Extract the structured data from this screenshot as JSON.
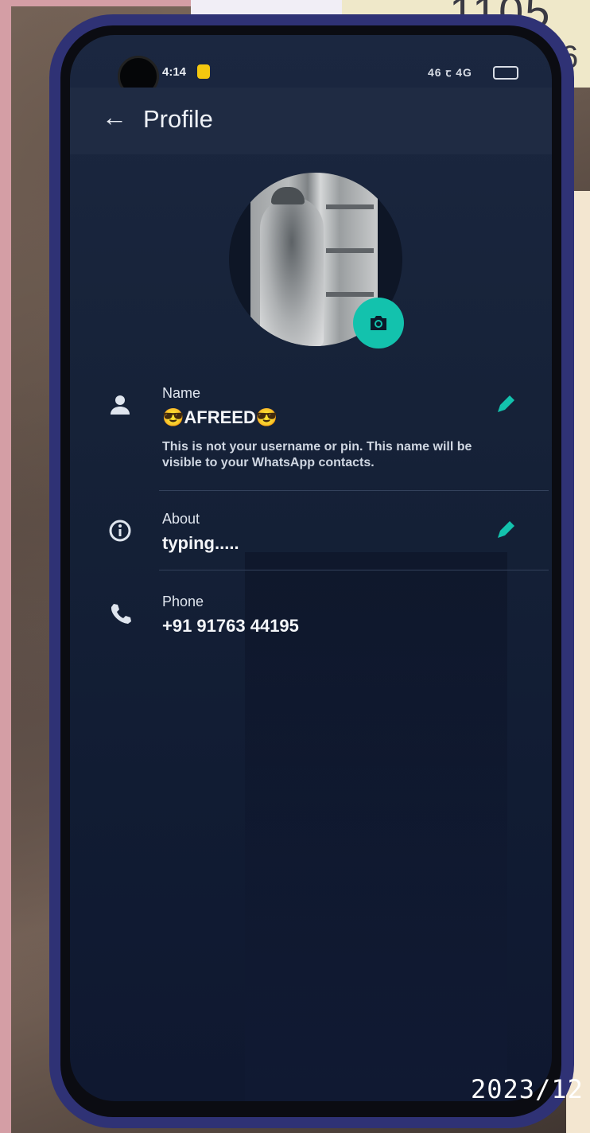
{
  "statusbar": {
    "time": "4:14",
    "right_icons": "46 ꞇ 4G"
  },
  "appbar": {
    "back_label": "←",
    "title": "Profile"
  },
  "profile": {
    "name_label": "Name",
    "name_value": "😎AFREED😎",
    "name_hint": "This is not your username or pin. This name will be visible to your WhatsApp contacts.",
    "about_label": "About",
    "about_value": "typing.....",
    "phone_label": "Phone",
    "phone_value": "+91 91763 44195"
  },
  "background": {
    "note_text": "1105",
    "note_digit": "6",
    "date_stamp": "2023/12"
  },
  "colors": {
    "accent": "#13c2ad",
    "screen": "#162238",
    "appbar": "#1f2b43",
    "case": "#2f3275"
  },
  "icons": [
    "back-arrow-icon",
    "person-icon",
    "info-icon",
    "phone-icon",
    "pencil-icon",
    "camera-icon"
  ]
}
